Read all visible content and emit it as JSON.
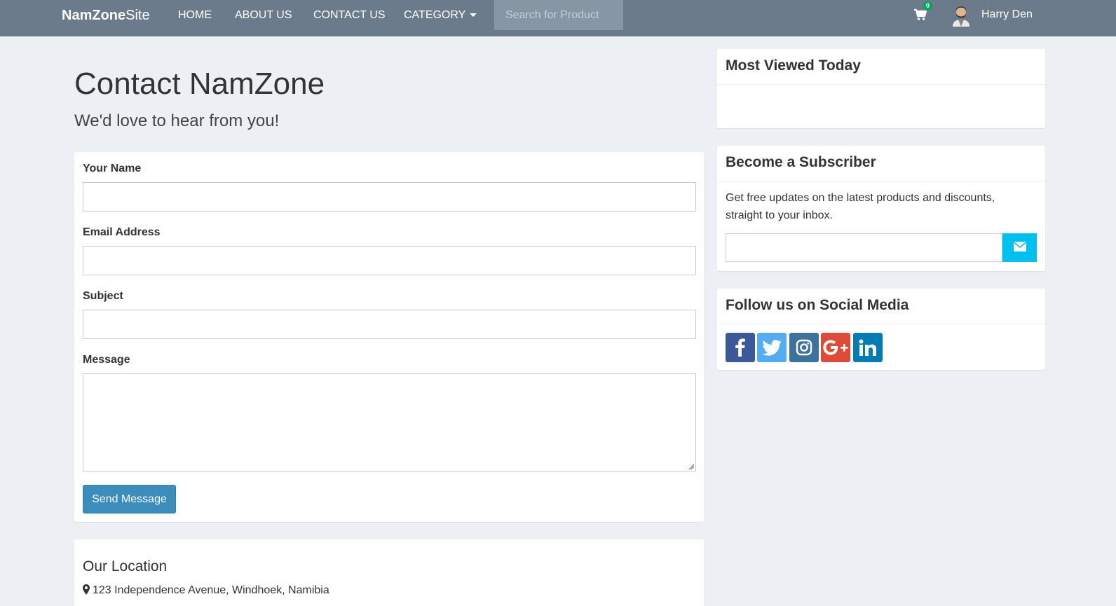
{
  "navbar": {
    "brand_bold": "NamZone",
    "brand_light": "Site",
    "links": [
      "HOME",
      "ABOUT US",
      "CONTACT US",
      "CATEGORY"
    ],
    "search_placeholder": "Search for Product",
    "cart_count": "0",
    "user_name": "Harry Den",
    "icons": {
      "cart": "shopping-cart-icon",
      "avatar": "user-avatar",
      "dropdown": "caret-down-icon"
    }
  },
  "header": {
    "title": "Contact NamZone",
    "subtitle": "We'd love to hear from you!"
  },
  "form": {
    "name_label": "Your Name",
    "name_value": "",
    "email_label": "Email Address",
    "email_value": "",
    "subject_label": "Subject",
    "subject_value": "",
    "message_label": "Message",
    "message_value": "",
    "submit_label": "Send Message"
  },
  "location": {
    "title": "Our Location",
    "address": "123 Independence Avenue, Windhoek, Namibia",
    "icon": "map-marker-icon"
  },
  "sidebar": {
    "most_viewed_title": "Most Viewed Today",
    "subscriber_title": "Become a Subscriber",
    "subscriber_text": "Get free updates on the latest products and discounts, straight to your inbox.",
    "subscriber_input_value": "",
    "subscriber_button_icon": "envelope-icon",
    "social_title": "Follow us on Social Media",
    "social": [
      {
        "name": "facebook-icon",
        "color": "#3b5998"
      },
      {
        "name": "twitter-icon",
        "color": "#55acee"
      },
      {
        "name": "instagram-icon",
        "color": "#3f729b"
      },
      {
        "name": "google-plus-icon",
        "color": "#dd4b39"
      },
      {
        "name": "linkedin-icon",
        "color": "#007bb6"
      }
    ]
  },
  "colors": {
    "navbar": "#6b7b8c",
    "page_bg": "#ecf0f5",
    "primary_button": "#3c8dbc",
    "subscribe_button": "#00c0ef",
    "cart_badge": "#00a65a"
  }
}
